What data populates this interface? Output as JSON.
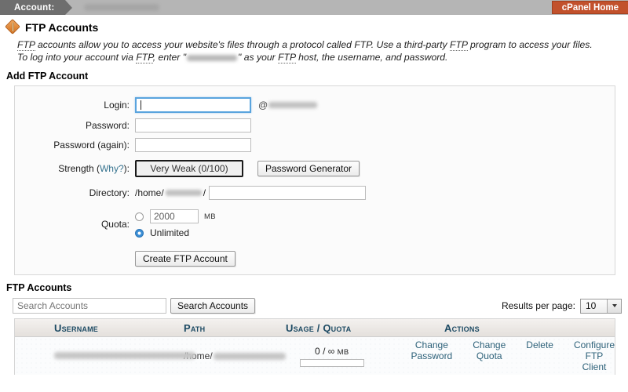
{
  "topbar": {
    "account_label": "Account:",
    "account_value_redacted": true,
    "cpanel_home_label": "cPanel Home",
    "cpanel_home_color": "#c2512c"
  },
  "page": {
    "icon": "ftp-compass-icon",
    "title": "FTP Accounts",
    "description_parts": {
      "p1": "FTP",
      "p2": " accounts allow you to access your website's files through a protocol called FTP. Use a third-party ",
      "p3": "FTP",
      "p4": " program to access your files. To log into your account via ",
      "p5": "FTP",
      "p6": ", enter \"",
      "p7": "\" as your ",
      "p8": "FTP",
      "p9": " host, the username, and password."
    }
  },
  "add_form": {
    "heading": "Add FTP Account",
    "login": {
      "label": "Login:",
      "value": "",
      "placeholder": "",
      "domain_suffix_prefix": "@"
    },
    "password": {
      "label": "Password:",
      "value": ""
    },
    "password_again": {
      "label": "Password (again):",
      "value": ""
    },
    "strength": {
      "label_prefix": "Strength (",
      "label_link": "Why?",
      "label_suffix": "):",
      "value": "Very Weak (0/100)",
      "generator_button": "Password Generator"
    },
    "directory": {
      "label": "Directory:",
      "prefix": "/home/",
      "separator": "/",
      "value": ""
    },
    "quota": {
      "label": "Quota:",
      "custom_value": "2000",
      "unit": "MB",
      "custom_selected": false,
      "unlimited_label": "Unlimited",
      "unlimited_selected": true
    },
    "submit_button": "Create FTP Account"
  },
  "accounts_list": {
    "heading": "FTP Accounts",
    "search_placeholder": "Search Accounts",
    "search_value": "",
    "search_button": "Search Accounts",
    "results_per_page_label": "Results per page:",
    "results_per_page_value": "10",
    "columns": [
      "Username",
      "Path",
      "Usage / Quota",
      "Actions"
    ],
    "rows": [
      {
        "username_redacted": true,
        "path_prefix": "/home/",
        "path_redacted": true,
        "usage_used": "0",
        "usage_separator": "/",
        "usage_quota": "∞",
        "usage_unit": "MB",
        "progress_percent": 0,
        "actions": [
          "Change\nPassword",
          "Change\nQuota",
          "Delete",
          "Configure\nFTP Client"
        ]
      }
    ]
  },
  "colors": {
    "accent_orange": "#c2512c",
    "link_blue": "#36738f",
    "header_navy": "#1d4a63",
    "action_link": "#2d6179"
  }
}
